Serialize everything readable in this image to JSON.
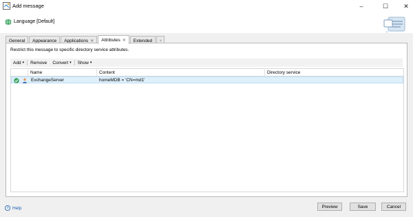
{
  "window": {
    "title": "Add message",
    "controls": {
      "minimize": "–",
      "maximize": "☐",
      "close": "✕"
    }
  },
  "header": {
    "language": "Language [Default]"
  },
  "tabs": [
    {
      "label": "General",
      "closable": false,
      "active": false
    },
    {
      "label": "Appearance",
      "closable": false,
      "active": false
    },
    {
      "label": "Applications",
      "closable": true,
      "active": false
    },
    {
      "label": "Attributes",
      "closable": true,
      "active": true
    },
    {
      "label": "Extended",
      "closable": false,
      "active": false
    }
  ],
  "tab_add": "+",
  "tab_close_glyph": "✕",
  "panel": {
    "description": "Restrict this message to specific directory service attributes.",
    "toolbar": {
      "add": "Add",
      "remove": "Remove",
      "convert": "Convert",
      "show": "Show",
      "caret": "▾"
    },
    "columns": {
      "name": "Name",
      "content": "Content",
      "directory_service": "Directory service"
    },
    "rows": [
      {
        "name": "ExchangeServer",
        "content": "homeMDB = 'CN=md1'",
        "directory_service": ""
      }
    ]
  },
  "footer": {
    "help": "Help",
    "preview": "Preview",
    "save": "Save",
    "cancel": "Cancel"
  },
  "colors": {
    "selection": "#dff0fb",
    "link": "#1a5fb4",
    "accent": "#2e8bdc"
  }
}
